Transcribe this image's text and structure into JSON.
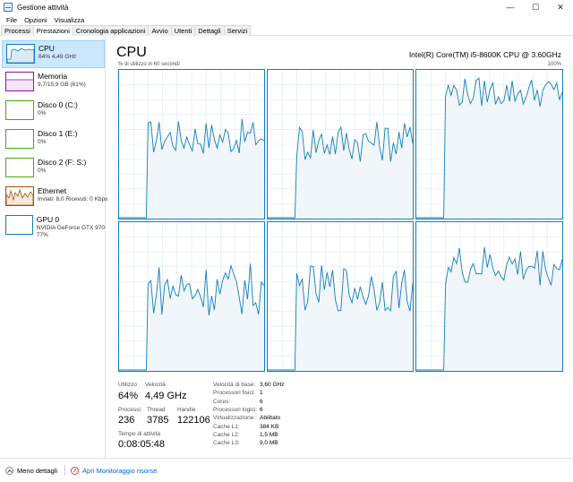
{
  "window": {
    "title": "Gestione attività",
    "controls": [
      "—",
      "☐",
      "✕"
    ]
  },
  "menu": [
    "File",
    "Opzioni",
    "Visualizza"
  ],
  "tabs": [
    {
      "label": "Processi",
      "active": false
    },
    {
      "label": "Prestazioni",
      "active": true
    },
    {
      "label": "Cronologia applicazioni",
      "active": false
    },
    {
      "label": "Avvio",
      "active": false
    },
    {
      "label": "Utenti",
      "active": false
    },
    {
      "label": "Dettagli",
      "active": false
    },
    {
      "label": "Servizi",
      "active": false
    }
  ],
  "sidebar": {
    "items": [
      {
        "title": "CPU",
        "sub": "64% 4,49 GHz",
        "color": "#117dbb",
        "icon": "cpu-graph-icon",
        "active": true
      },
      {
        "title": "Memoria",
        "sub": "9,7/15,9 GB (61%)",
        "color": "#8b12ae",
        "icon": "memory-graph-icon",
        "active": false
      },
      {
        "title": "Disco 0 (C:)",
        "sub": "0%",
        "color": "#4da60c",
        "icon": "disk-graph-icon",
        "active": false
      },
      {
        "title": "Disco 1 (E:)",
        "sub": "0%",
        "color": "#4da60c",
        "icon": "disk-graph-icon",
        "active": false
      },
      {
        "title": "Disco 2 (F: S:)",
        "sub": "0%",
        "color": "#4da60c",
        "icon": "disk-graph-icon",
        "active": false
      },
      {
        "title": "Ethernet",
        "sub": "Inviati: 8,0 Ricevuti: 0 Kbps",
        "color": "#a74f01",
        "icon": "ethernet-graph-icon",
        "active": false
      },
      {
        "title": "GPU 0",
        "sub": "NVIDIA GeForce GTX 970",
        "sub2": "77%",
        "color": "#117dbb",
        "icon": "gpu-graph-icon",
        "active": false
      }
    ]
  },
  "main": {
    "heading": "CPU",
    "model": "Intel(R) Core(TM) i5-8600K CPU @ 3.60GHz",
    "caption": "% di utilizzo in 60 secondi",
    "max_label": "100%",
    "graph_color": "#117dbb",
    "graph_fill": "#f1f6fa"
  },
  "stats": {
    "utilizzo_label": "Utilizzo",
    "utilizzo_value": "64%",
    "velocita_label": "Velocità",
    "velocita_value": "4,49 GHz",
    "processi_label": "Processi",
    "processi_value": "236",
    "thread_label": "Thread",
    "thread_value": "3785",
    "handle_label": "Handle",
    "handle_value": "122106",
    "uptime_label": "Tempo di attività",
    "uptime_value": "0:08:05:48"
  },
  "specs": [
    {
      "label": "Velocità di base:",
      "value": "3,60 GHz"
    },
    {
      "label": "Processori fisici:",
      "value": "1"
    },
    {
      "label": "Cores:",
      "value": "6"
    },
    {
      "label": "Processori logici:",
      "value": "6"
    },
    {
      "label": "Virtualizzazione:",
      "value": "Abilitato"
    },
    {
      "label": "Cache L1:",
      "value": "384 KB"
    },
    {
      "label": "Cache L2:",
      "value": "1,5 MB"
    },
    {
      "label": "Cache L3:",
      "value": "9,0 MB"
    }
  ],
  "footer": {
    "less_details": "Meno dettagli",
    "resource_monitor": "Apri Monitoraggio risorse"
  }
}
